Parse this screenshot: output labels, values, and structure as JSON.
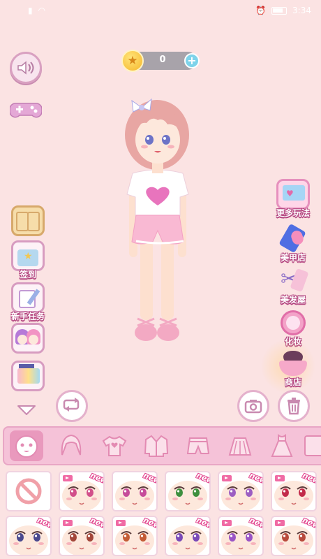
{
  "status_bar": {
    "time": "3:34"
  },
  "currency": {
    "count": "0",
    "add": "+",
    "coin_symbol": "★"
  },
  "side_menu_left": [
    {
      "id": "wardrobe",
      "label": ""
    },
    {
      "id": "checkin",
      "label": "签到"
    },
    {
      "id": "novice_tasks",
      "label": "新手任务"
    },
    {
      "id": "friends",
      "label": ""
    },
    {
      "id": "album",
      "label": ""
    }
  ],
  "side_menu_right": [
    {
      "id": "more_games",
      "label": "更多玩法"
    },
    {
      "id": "nail_shop",
      "label": "美甲店"
    },
    {
      "id": "hair_salon",
      "label": "美发屋"
    },
    {
      "id": "makeup",
      "label": "化妆"
    },
    {
      "id": "shop",
      "label": "商店"
    }
  ],
  "categories": [
    {
      "id": "face",
      "icon": "face-icon"
    },
    {
      "id": "hair",
      "icon": "hair-icon"
    },
    {
      "id": "tshirt",
      "icon": "tshirt-icon"
    },
    {
      "id": "jacket",
      "icon": "jacket-icon"
    },
    {
      "id": "shorts",
      "icon": "shorts-icon"
    },
    {
      "id": "skirt",
      "icon": "skirt-icon"
    },
    {
      "id": "dress",
      "icon": "dress-icon"
    }
  ],
  "grid": {
    "new_label": "new",
    "row1": [
      {
        "type": "none"
      },
      {
        "eye_color": "#d24f8a",
        "is_new": true,
        "video": true
      },
      {
        "eye_color": "#c64a9a",
        "is_new": true,
        "video": false
      },
      {
        "eye_color": "#3e8f3e",
        "is_new": true,
        "video": false
      },
      {
        "eye_color": "#9c5ec2",
        "is_new": true,
        "video": true
      },
      {
        "eye_color": "#c22a4a",
        "is_new": true,
        "video": true
      }
    ],
    "row2": [
      {
        "eye_color": "#4b4a8f",
        "is_new": true,
        "video": false
      },
      {
        "eye_color": "#a3473a",
        "is_new": true,
        "video": true
      },
      {
        "eye_color": "#c45c36",
        "is_new": true,
        "video": true
      },
      {
        "eye_color": "#7a4ab8",
        "is_new": true,
        "video": false
      },
      {
        "eye_color": "#9a55c6",
        "is_new": true,
        "video": true
      },
      {
        "eye_color": "#b84a3c",
        "is_new": true,
        "video": true
      }
    ]
  },
  "colors": {
    "background": "#fbe3e3",
    "accent": "#e999bd",
    "label_outline": "#b3437e"
  }
}
